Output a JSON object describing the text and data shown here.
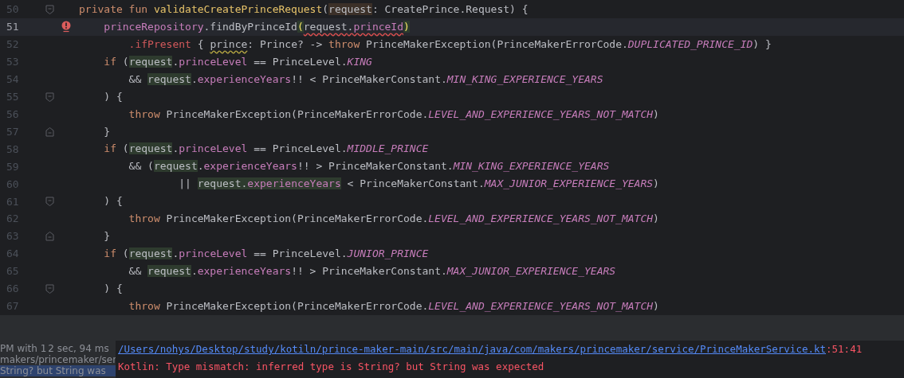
{
  "editor": {
    "lines": [
      {
        "number": "50",
        "current": false,
        "fold_start": true,
        "tokens": [
          {
            "kind": "keyword",
            "text": "private fun "
          },
          {
            "kind": "function",
            "text": "validateCreatePrinceRequest"
          },
          {
            "kind": "plain",
            "text": "("
          },
          {
            "kind": "plain",
            "text": "request",
            "declaration_highlight": true
          },
          {
            "kind": "plain",
            "text": ": CreatePrince.Request) {"
          }
        ]
      },
      {
        "number": "51",
        "current": true,
        "error": true,
        "tokens": [
          {
            "kind": "property",
            "text": "    princeRepository"
          },
          {
            "kind": "plain",
            "text": ".findByPrinceId"
          },
          {
            "kind": "brace",
            "text": "(",
            "usage_highlight": true
          },
          {
            "kind": "plain",
            "text": "request",
            "error_underline": true
          },
          {
            "kind": "plain",
            "text": ".",
            "error_underline": true
          },
          {
            "kind": "property",
            "text": "princeId",
            "error_underline": true
          },
          {
            "kind": "brace",
            "text": ")",
            "usage_highlight": true
          }
        ]
      },
      {
        "number": "52",
        "current": false,
        "tokens": [
          {
            "kind": "extension",
            "text": "        .ifPresent"
          },
          {
            "kind": "plain",
            "text": " { "
          },
          {
            "kind": "plain",
            "text": "prince",
            "warning_underline": true
          },
          {
            "kind": "plain",
            "text": ": Prince? -> "
          },
          {
            "kind": "keyword",
            "text": "throw"
          },
          {
            "kind": "plain",
            "text": " PrinceMakerException(PrinceMakerErrorCode."
          },
          {
            "kind": "constant",
            "text": "DUPLICATED_PRINCE_ID"
          },
          {
            "kind": "plain",
            "text": ") }"
          }
        ]
      },
      {
        "number": "53",
        "current": false,
        "tokens": [
          {
            "kind": "keyword",
            "text": "    if"
          },
          {
            "kind": "plain",
            "text": " ("
          },
          {
            "kind": "plain",
            "text": "request",
            "usage_highlight": true
          },
          {
            "kind": "plain",
            "text": "."
          },
          {
            "kind": "property",
            "text": "princeLevel"
          },
          {
            "kind": "plain",
            "text": " == PrinceLevel."
          },
          {
            "kind": "constant",
            "text": "KING"
          }
        ]
      },
      {
        "number": "54",
        "current": false,
        "tokens": [
          {
            "kind": "plain",
            "text": "        && "
          },
          {
            "kind": "plain",
            "text": "request",
            "usage_highlight": true
          },
          {
            "kind": "plain",
            "text": "."
          },
          {
            "kind": "property",
            "text": "experienceYears"
          },
          {
            "kind": "plain",
            "text": "!! < PrinceMakerConstant."
          },
          {
            "kind": "constant",
            "text": "MIN_KING_EXPERIENCE_YEARS"
          }
        ]
      },
      {
        "number": "55",
        "current": false,
        "fold_start": true,
        "tokens": [
          {
            "kind": "plain",
            "text": "    ) {"
          }
        ]
      },
      {
        "number": "56",
        "current": false,
        "tokens": [
          {
            "kind": "keyword",
            "text": "        throw"
          },
          {
            "kind": "plain",
            "text": " PrinceMakerException(PrinceMakerErrorCode."
          },
          {
            "kind": "constant",
            "text": "LEVEL_AND_EXPERIENCE_YEARS_NOT_MATCH"
          },
          {
            "kind": "plain",
            "text": ")"
          }
        ]
      },
      {
        "number": "57",
        "current": false,
        "fold_end": true,
        "tokens": [
          {
            "kind": "plain",
            "text": "    }"
          }
        ]
      },
      {
        "number": "58",
        "current": false,
        "tokens": [
          {
            "kind": "keyword",
            "text": "    if"
          },
          {
            "kind": "plain",
            "text": " ("
          },
          {
            "kind": "plain",
            "text": "request",
            "usage_highlight": true
          },
          {
            "kind": "plain",
            "text": "."
          },
          {
            "kind": "property",
            "text": "princeLevel"
          },
          {
            "kind": "plain",
            "text": " == PrinceLevel."
          },
          {
            "kind": "constant",
            "text": "MIDDLE_PRINCE"
          }
        ]
      },
      {
        "number": "59",
        "current": false,
        "tokens": [
          {
            "kind": "plain",
            "text": "        && ("
          },
          {
            "kind": "plain",
            "text": "request",
            "usage_highlight": true
          },
          {
            "kind": "plain",
            "text": "."
          },
          {
            "kind": "property",
            "text": "experienceYears"
          },
          {
            "kind": "plain",
            "text": "!! > PrinceMakerConstant."
          },
          {
            "kind": "constant",
            "text": "MIN_KING_EXPERIENCE_YEARS"
          }
        ]
      },
      {
        "number": "60",
        "current": false,
        "tokens": [
          {
            "kind": "plain",
            "text": "                || "
          },
          {
            "kind": "plain",
            "text": "request",
            "usage_highlight": true
          },
          {
            "kind": "plain",
            "text": ".",
            "usage_highlight": true
          },
          {
            "kind": "property",
            "text": "experienceYears",
            "usage_highlight": true
          },
          {
            "kind": "plain",
            "text": " < PrinceMakerConstant."
          },
          {
            "kind": "constant",
            "text": "MAX_JUNIOR_EXPERIENCE_YEARS"
          },
          {
            "kind": "plain",
            "text": ")"
          }
        ]
      },
      {
        "number": "61",
        "current": false,
        "fold_start": true,
        "tokens": [
          {
            "kind": "plain",
            "text": "    ) {"
          }
        ]
      },
      {
        "number": "62",
        "current": false,
        "tokens": [
          {
            "kind": "keyword",
            "text": "        throw"
          },
          {
            "kind": "plain",
            "text": " PrinceMakerException(PrinceMakerErrorCode."
          },
          {
            "kind": "constant",
            "text": "LEVEL_AND_EXPERIENCE_YEARS_NOT_MATCH"
          },
          {
            "kind": "plain",
            "text": ")"
          }
        ]
      },
      {
        "number": "63",
        "current": false,
        "fold_end": true,
        "tokens": [
          {
            "kind": "plain",
            "text": "    }"
          }
        ]
      },
      {
        "number": "64",
        "current": false,
        "tokens": [
          {
            "kind": "keyword",
            "text": "    if"
          },
          {
            "kind": "plain",
            "text": " ("
          },
          {
            "kind": "plain",
            "text": "request",
            "usage_highlight": true
          },
          {
            "kind": "plain",
            "text": "."
          },
          {
            "kind": "property",
            "text": "princeLevel"
          },
          {
            "kind": "plain",
            "text": " == PrinceLevel."
          },
          {
            "kind": "constant",
            "text": "JUNIOR_PRINCE"
          }
        ]
      },
      {
        "number": "65",
        "current": false,
        "tokens": [
          {
            "kind": "plain",
            "text": "        && "
          },
          {
            "kind": "plain",
            "text": "request",
            "usage_highlight": true
          },
          {
            "kind": "plain",
            "text": "."
          },
          {
            "kind": "property",
            "text": "experienceYears"
          },
          {
            "kind": "plain",
            "text": "!! > PrinceMakerConstant."
          },
          {
            "kind": "constant",
            "text": "MAX_JUNIOR_EXPERIENCE_YEARS"
          }
        ]
      },
      {
        "number": "66",
        "current": false,
        "fold_start": true,
        "tokens": [
          {
            "kind": "plain",
            "text": "    ) {"
          }
        ]
      },
      {
        "number": "67",
        "current": false,
        "tokens": [
          {
            "kind": "keyword",
            "text": "        throw"
          },
          {
            "kind": "plain",
            "text": " PrinceMakerException(PrinceMakerErrorCode."
          },
          {
            "kind": "constant",
            "text": "LEVEL_AND_EXPERIENCE_YEARS_NOT_MATCH"
          },
          {
            "kind": "plain",
            "text": ")"
          }
        ]
      }
    ]
  },
  "build_panel": {
    "tree": [
      {
        "text": "PM with 1",
        "time": "2 sec, 94 ms",
        "selected": false
      },
      {
        "text": "makers/princemaker/ser",
        "selected": false
      },
      {
        "text": "String? but String was",
        "selected": true
      }
    ],
    "console": {
      "path": "/Users/nohys/Desktop/study/kotiln/prince-maker-main/src/main/java/com/makers/princemaker/service/PrinceMakerService.kt",
      "position": ":51:41",
      "message": "Kotlin: Type mismatch: inferred type is String? but String was expected"
    }
  }
}
